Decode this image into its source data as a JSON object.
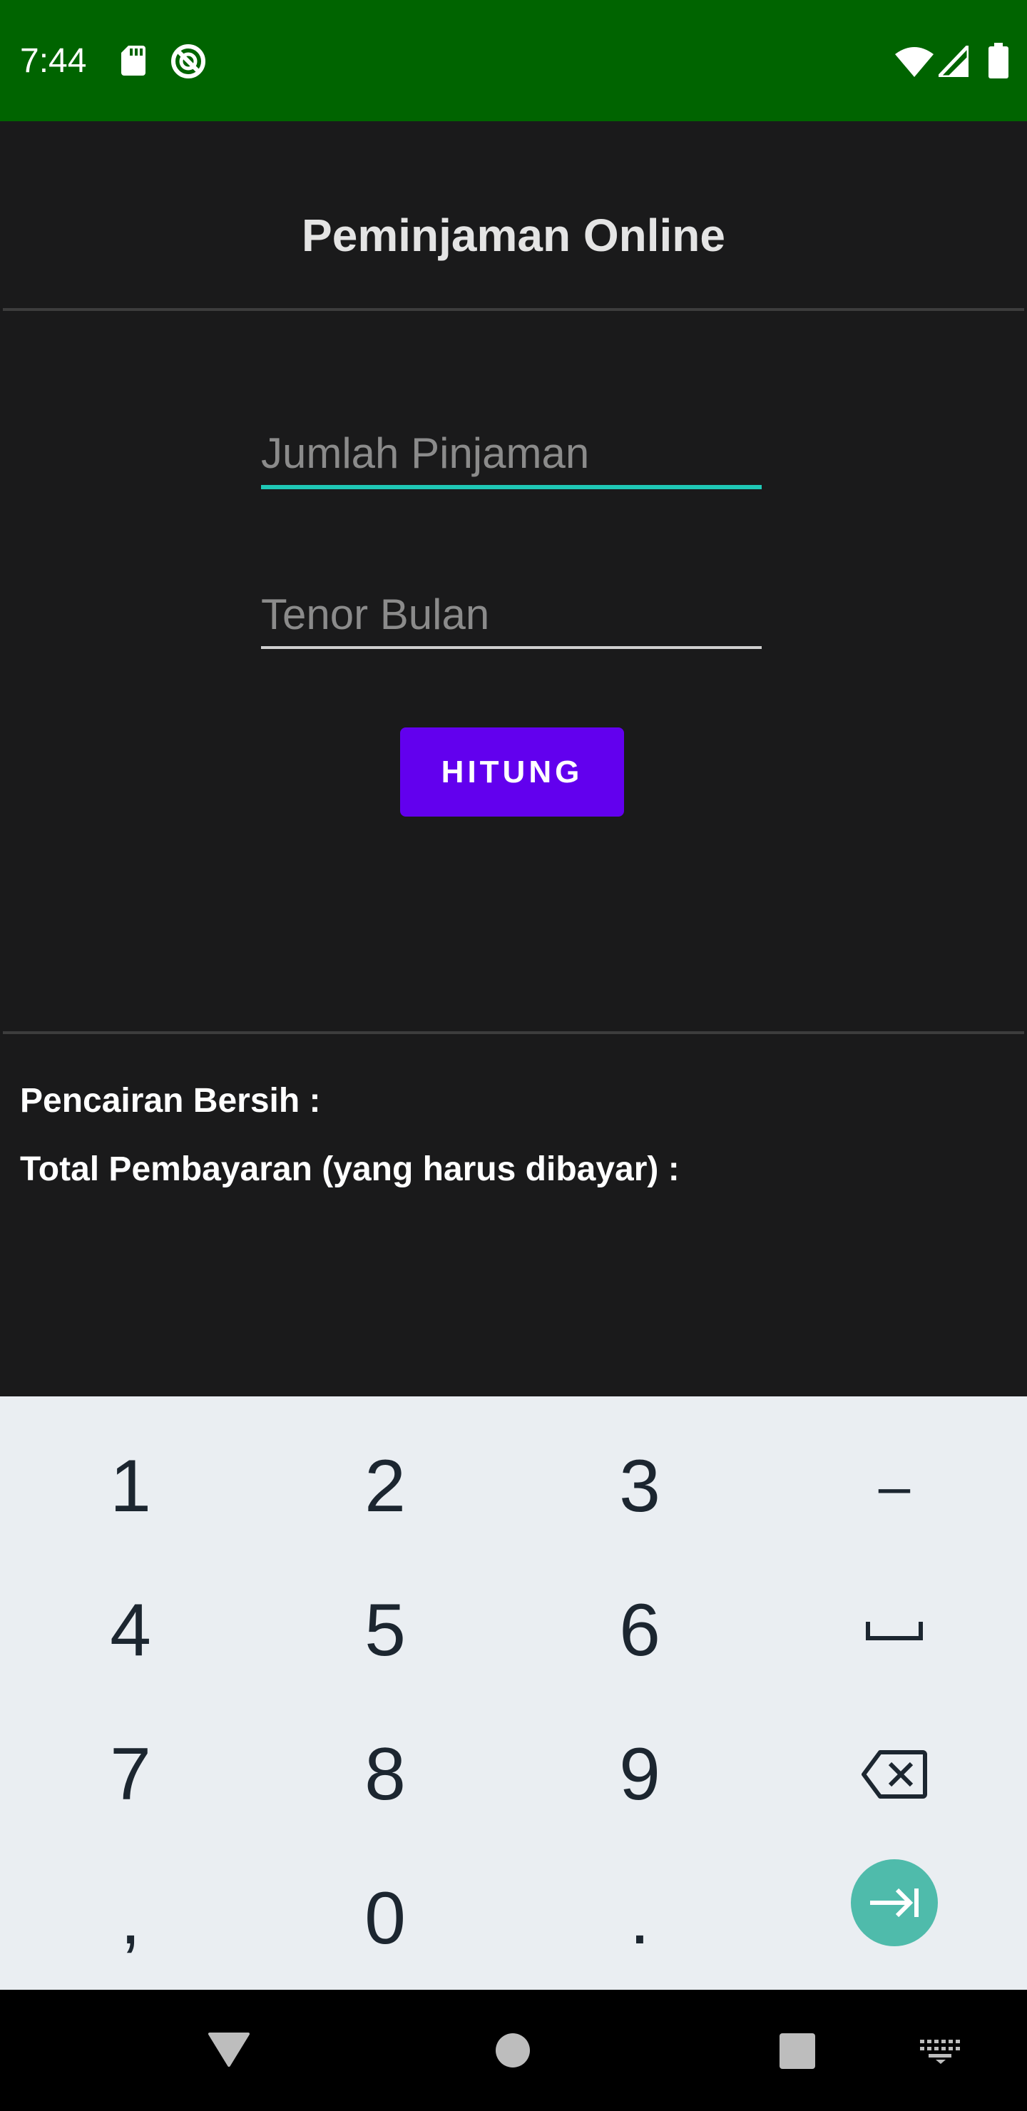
{
  "status_bar": {
    "time": "7:44",
    "icons": [
      "sd-card-icon",
      "dnd-icon",
      "wifi-icon",
      "signal-icon",
      "battery-icon"
    ],
    "background": "#006400"
  },
  "app": {
    "title": "Peminjaman Online",
    "background": "#1a1a1b",
    "loan_amount": {
      "value": "",
      "placeholder": "Jumlah Pinjaman",
      "focused": true
    },
    "tenor_months": {
      "value": "",
      "placeholder": "Tenor Bulan"
    },
    "calculate_label": "HITUNG",
    "accent": "#6200ee",
    "focus_color": "#1fc8b6",
    "results": {
      "net_disbursement_label": "Pencairan Bersih :",
      "total_payment_label": "Total Pembayaran (yang harus dibayar) :"
    }
  },
  "keyboard": {
    "keys": [
      "1",
      "2",
      "3",
      "-",
      "4",
      "5",
      "6",
      "space",
      "7",
      "8",
      "9",
      "backspace",
      ",",
      "0",
      ".",
      "next"
    ],
    "labels": {
      "k1": "1",
      "k2": "2",
      "k3": "3",
      "dash": "–",
      "k4": "4",
      "k5": "5",
      "k6": "6",
      "k7": "7",
      "k8": "8",
      "k9": "9",
      "comma": ",",
      "k0": "0",
      "period": "."
    },
    "background": "#eaeef2",
    "enter_color": "#4fbbab"
  },
  "nav_bar": {
    "buttons": [
      "back-icon",
      "home-icon",
      "recents-icon",
      "keyboard-switch-icon"
    ]
  }
}
